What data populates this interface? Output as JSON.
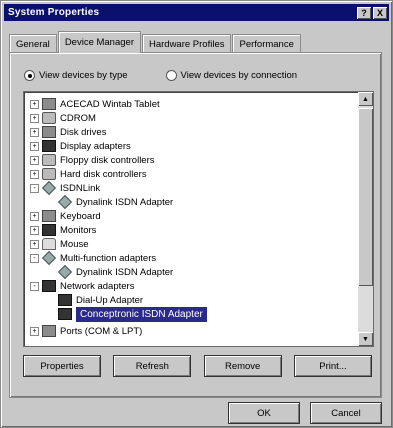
{
  "window": {
    "title": "System Properties",
    "help_glyph": "?",
    "close_glyph": "X"
  },
  "tabs": [
    {
      "label": "General"
    },
    {
      "label": "Device Manager"
    },
    {
      "label": "Hardware Profiles"
    },
    {
      "label": "Performance"
    }
  ],
  "view": {
    "by_type_label": "View devices by type",
    "by_connection_label": "View devices by connection",
    "selected": "by_type"
  },
  "tree": [
    {
      "label": "ACECAD Wintab Tablet",
      "expander": "+",
      "icon": "tablet-icon"
    },
    {
      "label": "CDROM",
      "expander": "+",
      "icon": "cdrom-icon"
    },
    {
      "label": "Disk drives",
      "expander": "+",
      "icon": "disk-drive-icon"
    },
    {
      "label": "Display adapters",
      "expander": "+",
      "icon": "display-adapter-icon"
    },
    {
      "label": "Floppy disk controllers",
      "expander": "+",
      "icon": "floppy-controller-icon"
    },
    {
      "label": "Hard disk controllers",
      "expander": "+",
      "icon": "hard-disk-controller-icon"
    },
    {
      "label": "ISDNLink",
      "expander": "-",
      "icon": "isdn-icon"
    },
    {
      "label": "Dynalink ISDN Adapter",
      "expander": "",
      "icon": "adapter-icon"
    },
    {
      "label": "Keyboard",
      "expander": "+",
      "icon": "keyboard-icon"
    },
    {
      "label": "Monitors",
      "expander": "+",
      "icon": "monitor-icon"
    },
    {
      "label": "Mouse",
      "expander": "+",
      "icon": "mouse-icon"
    },
    {
      "label": "Multi-function adapters",
      "expander": "-",
      "icon": "multifunction-icon"
    },
    {
      "label": "Dynalink ISDN Adapter",
      "expander": "",
      "icon": "adapter-icon"
    },
    {
      "label": "Network adapters",
      "expander": "-",
      "icon": "network-adapter-icon"
    },
    {
      "label": "Dial-Up Adapter",
      "expander": "",
      "icon": "network-card-icon"
    },
    {
      "label": "Conceptronic ISDN Adapter",
      "expander": "",
      "icon": "network-card-icon",
      "selected": true
    },
    {
      "label": "Ports (COM & LPT)",
      "expander": "+",
      "icon": "ports-icon"
    }
  ],
  "buttons": {
    "properties": "Properties",
    "refresh": "Refresh",
    "remove": "Remove",
    "print": "Print..."
  },
  "footer": {
    "ok": "OK",
    "cancel": "Cancel"
  }
}
